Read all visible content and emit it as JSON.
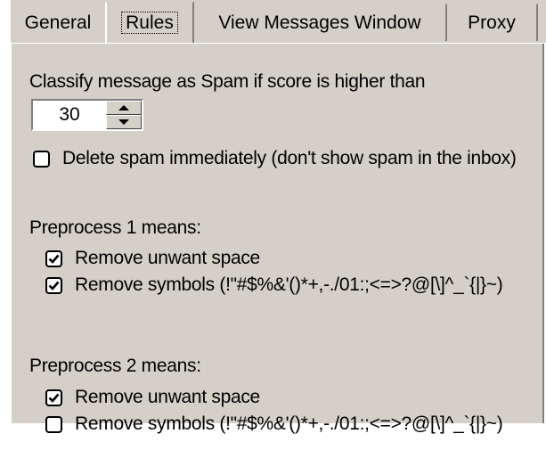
{
  "tabs": [
    {
      "label": "General",
      "active": false
    },
    {
      "label": "Rules",
      "active": true
    },
    {
      "label": "View Messages Window",
      "active": false
    },
    {
      "label": "Proxy",
      "active": false
    }
  ],
  "classify_label": "Classify message as Spam if score is higher than",
  "threshold": {
    "value": "30"
  },
  "delete_spam": {
    "label": "Delete spam immediately (don't show spam in the inbox)",
    "checked": false
  },
  "pre1": {
    "heading": "Preprocess 1 means:",
    "remove_space": {
      "label": "Remove unwant space",
      "checked": true
    },
    "remove_symbols": {
      "label": "Remove symbols  (!\"#$%&'()*+,-./01:;<=>?@[\\]^_`{|}~)",
      "checked": true
    }
  },
  "pre2": {
    "heading": "Preprocess 2 means:",
    "remove_space": {
      "label": "Remove unwant space",
      "checked": true
    },
    "remove_symbols": {
      "label": "Remove symbols  (!\"#$%&'()*+,-./01:;<=>?@[\\]^_`{|}~)",
      "checked": false
    }
  }
}
